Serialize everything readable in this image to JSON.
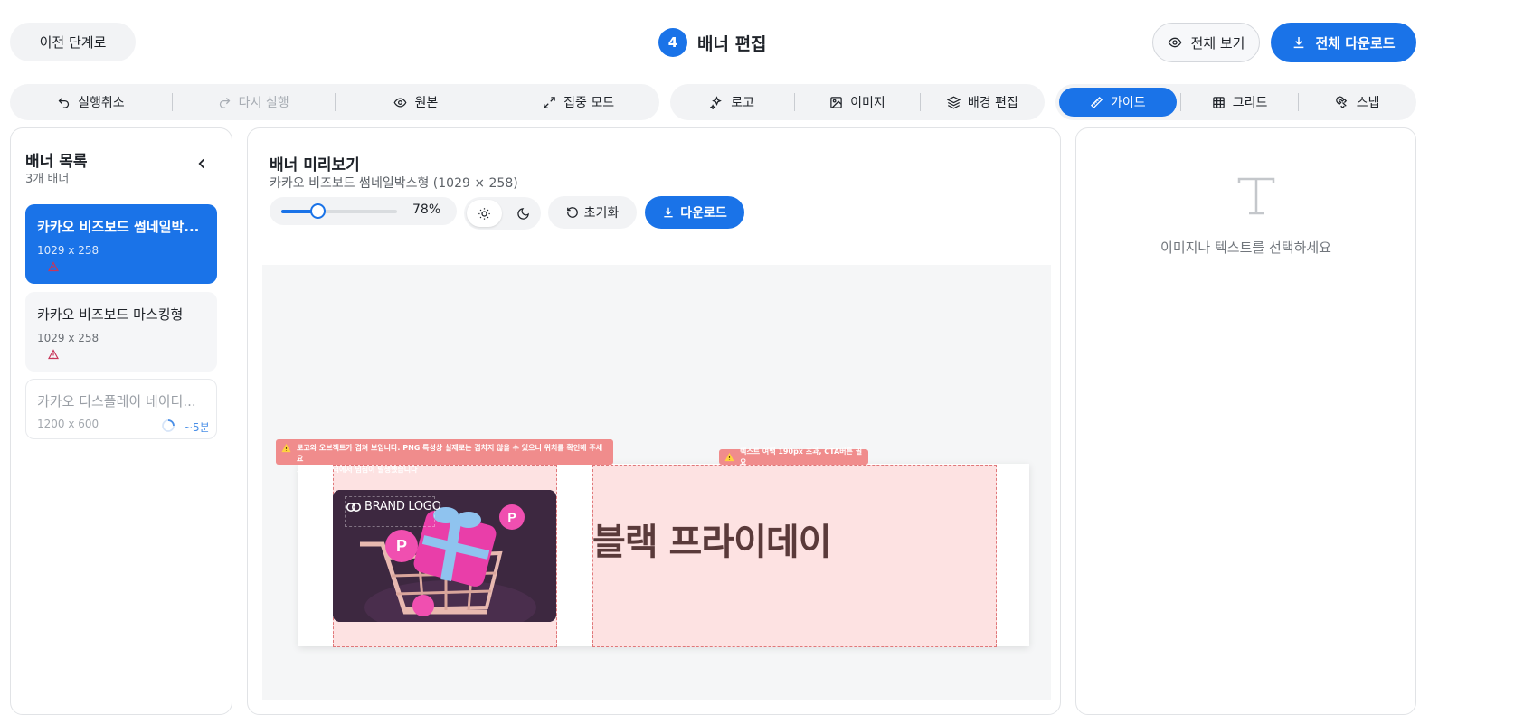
{
  "header": {
    "back_label": "이전 단계로",
    "step_number": "4",
    "step_title": "배너 편집",
    "view_all_label": "전체 보기",
    "download_all_label": "전체 다운로드"
  },
  "toolbar": {
    "history": [
      {
        "label": "실행취소",
        "icon": "undo-icon",
        "enabled": true
      },
      {
        "label": "다시 실행",
        "icon": "redo-icon",
        "enabled": false
      },
      {
        "label": "원본",
        "icon": "eye-icon",
        "enabled": true
      },
      {
        "label": "집중 모드",
        "icon": "expand-icon",
        "enabled": true
      }
    ],
    "tools": [
      {
        "label": "로고",
        "icon": "sparkle-icon"
      },
      {
        "label": "이미지",
        "icon": "image-icon"
      },
      {
        "label": "배경 편집",
        "icon": "layers-icon"
      }
    ],
    "guides": [
      {
        "label": "가이드",
        "icon": "ruler-icon",
        "active": true
      },
      {
        "label": "그리드",
        "icon": "grid-icon",
        "active": false
      },
      {
        "label": "스냅",
        "icon": "magnet-icon",
        "active": false
      }
    ]
  },
  "banner_list": {
    "title": "배너 목록",
    "count_label": "3개 배너",
    "items": [
      {
        "name": "카카오 비즈보드 썸네일박...",
        "size": "1029 x 258",
        "status": "warning",
        "selected": true
      },
      {
        "name": "카카오 비즈보드 마스킹형",
        "size": "1029 x 258",
        "status": "warning",
        "selected": false
      },
      {
        "name": "카카오 디스플레이 네이티...",
        "size": "1200 x 600",
        "status": "loading",
        "eta": "~5분",
        "selected": false
      }
    ]
  },
  "preview": {
    "title": "배너 미리보기",
    "subtitle": "카카오 비즈보드 썸네일박스형 (1029 × 258)",
    "zoom_percent": 78,
    "zoom_label": "78%",
    "theme": "light",
    "reset_label": "초기화",
    "download_label": "다운로드",
    "warning_logo_line1": "로고와 오브젝트가 겹쳐 보입니다. PNG 특성상 실제로는 겹치지 않을 수 있으니 위치를 확인해 주세요",
    "warning_logo_line2": "오브젝트 영역에서 넘침이 발생했습니다",
    "warning_text": "텍스트 여백 190px 초과, CTA버튼 필요",
    "brand_logo_text": "BRAND LOGO",
    "headline": "블랙 프라이데이"
  },
  "properties": {
    "empty_icon": "text-icon",
    "empty_message": "이미지나 텍스트를 선택하세요"
  },
  "colors": {
    "accent": "#1a73e8",
    "warning": "#f08c8c",
    "zone_fill": "#fde2e2",
    "product_bg": "#3d2840",
    "headline": "#5a3a3a"
  }
}
